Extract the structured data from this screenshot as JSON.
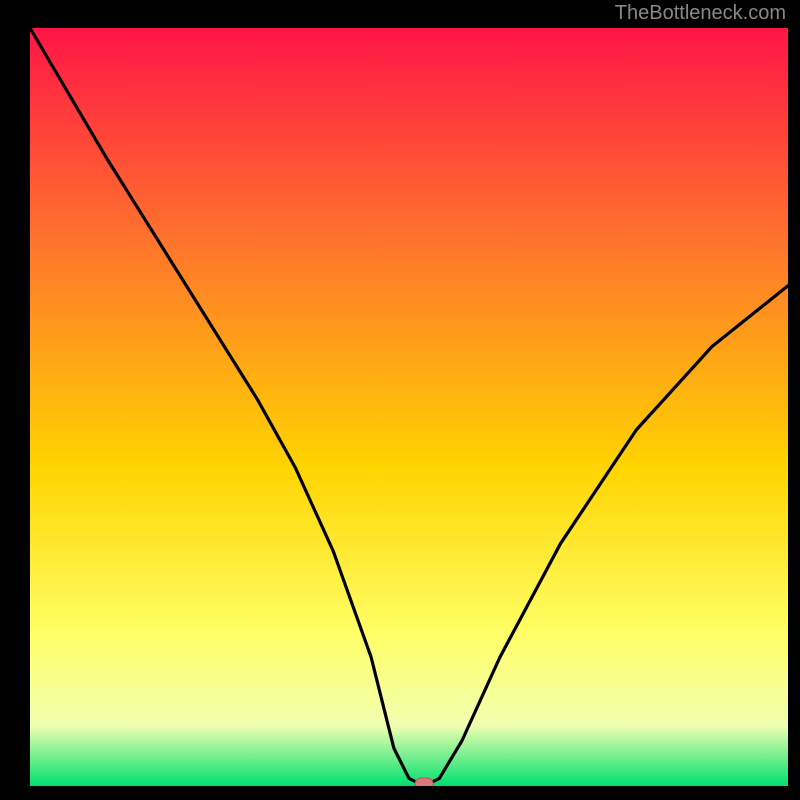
{
  "watermark": "TheBottleneck.com",
  "chart_data": {
    "type": "line",
    "title": "",
    "xlabel": "",
    "ylabel": "",
    "xlim": [
      0,
      100
    ],
    "ylim": [
      0,
      100
    ],
    "x": [
      0,
      10,
      20,
      30,
      35,
      40,
      45,
      48,
      50,
      52,
      54,
      57,
      62,
      70,
      80,
      90,
      100
    ],
    "values": [
      100,
      83,
      67,
      51,
      42,
      31,
      17,
      5,
      1,
      0,
      1,
      6,
      17,
      32,
      47,
      58,
      66
    ],
    "colors": {
      "gradient_top": "#ff1547",
      "gradient_mid1": "#ff7a2a",
      "gradient_mid2": "#ffd400",
      "gradient_mid3": "#ffff66",
      "gradient_mid4": "#f0ffb0",
      "gradient_bottom": "#00e070",
      "curve": "#000000",
      "marker_fill": "#d97a7a",
      "marker_stroke": "#b85a5a"
    },
    "marker": {
      "x": 52,
      "y": 0
    }
  }
}
